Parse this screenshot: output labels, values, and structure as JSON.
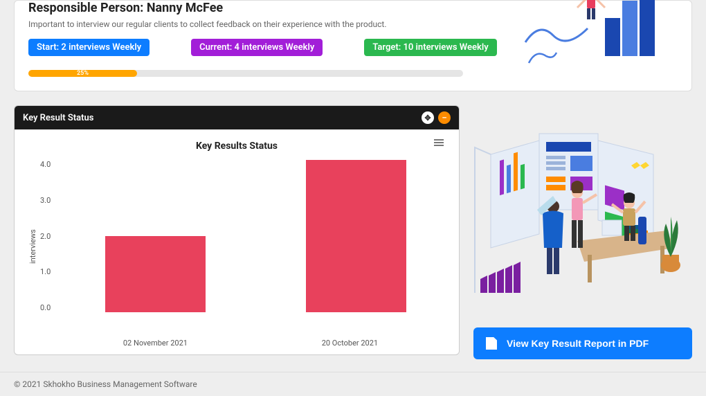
{
  "top": {
    "title_label": "Responsible Person:",
    "title_name": "Nanny McFee",
    "description": "Important to interview our regular clients to collect feedback on their experience with the product.",
    "start_badge": "Start: 2 interviews Weekly",
    "current_badge": "Current: 4 interviews Weekly",
    "target_badge": "Target: 10 interviews Weekly",
    "progress_pct": "25%",
    "progress_width": "25%"
  },
  "chart_panel": {
    "header": "Key Result Status",
    "title": "Key Results Status"
  },
  "chart_data": {
    "type": "bar",
    "title": "Key Results Status",
    "xlabel": "",
    "ylabel": "interviews",
    "ylim": [
      0,
      4
    ],
    "yticks": [
      "0.0",
      "1.0",
      "2.0",
      "3.0",
      "4.0"
    ],
    "categories": [
      "02 November 2021",
      "20 October 2021"
    ],
    "values": [
      2,
      4
    ]
  },
  "pdf_button": "View Key Result Report in PDF",
  "footer": "© 2021 Skhokho Business Management Software"
}
